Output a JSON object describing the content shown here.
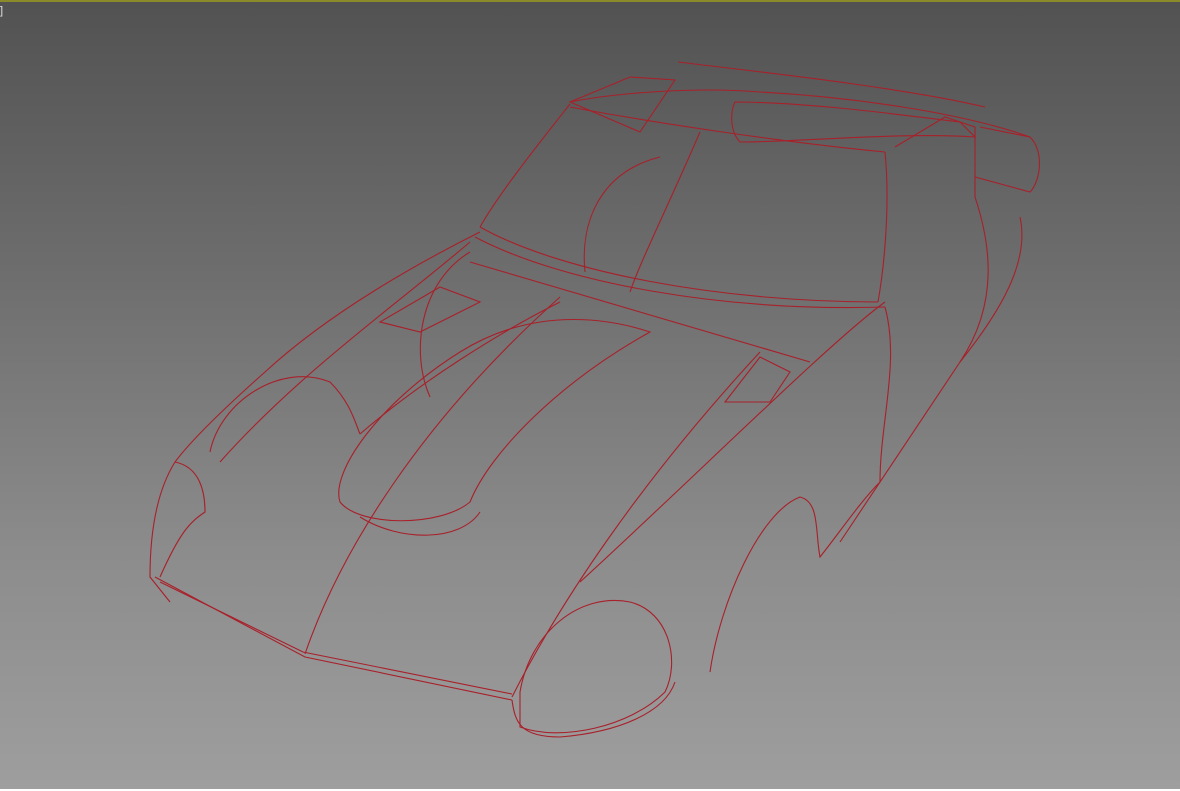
{
  "viewport": {
    "label_fragment": "]",
    "active_border_color": "#8a8a2a",
    "wire_color": "#a8202a"
  }
}
